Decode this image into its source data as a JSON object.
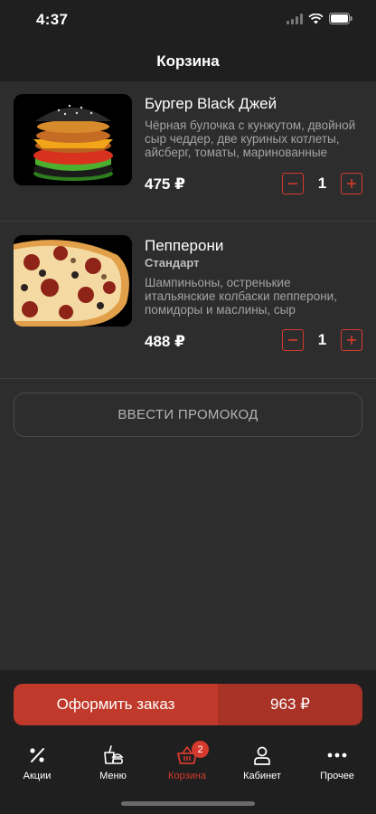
{
  "status_bar": {
    "time": "4:37"
  },
  "header": {
    "title": "Корзина"
  },
  "cart": {
    "items": [
      {
        "name": "Бургер Black Джей",
        "variant": "",
        "description": "Чёрная булочка с кунжутом, двойной сыр чеддер, две куриных котлеты, айсберг, томаты, маринованные огур…",
        "price": "475 ₽",
        "quantity": "1",
        "image_icon": "burger-image"
      },
      {
        "name": "Пепперони",
        "variant": "Стандарт",
        "description": "Шампиньоны, остренькие итальянские колбаски пепперони, помидоры и маслины, сыр Моцарелла, острый пе…",
        "price": "488 ₽",
        "quantity": "1",
        "image_icon": "pizza-image"
      }
    ]
  },
  "promo": {
    "label": "ВВЕСТИ ПРОМОКОД"
  },
  "checkout": {
    "label": "Оформить заказ",
    "total": "963 ₽"
  },
  "tabs": [
    {
      "label": "Акции",
      "icon": "percent-icon"
    },
    {
      "label": "Меню",
      "icon": "food-menu-icon"
    },
    {
      "label": "Корзина",
      "icon": "basket-icon",
      "badge": "2",
      "active": true
    },
    {
      "label": "Кабинет",
      "icon": "user-icon"
    },
    {
      "label": "Прочее",
      "icon": "more-icon"
    }
  ],
  "colors": {
    "accent": "#d63a2e",
    "checkout_main": "#c0392b",
    "checkout_sum": "#a93226",
    "background": "#2d2d2d",
    "bars": "#1f1f1f"
  }
}
